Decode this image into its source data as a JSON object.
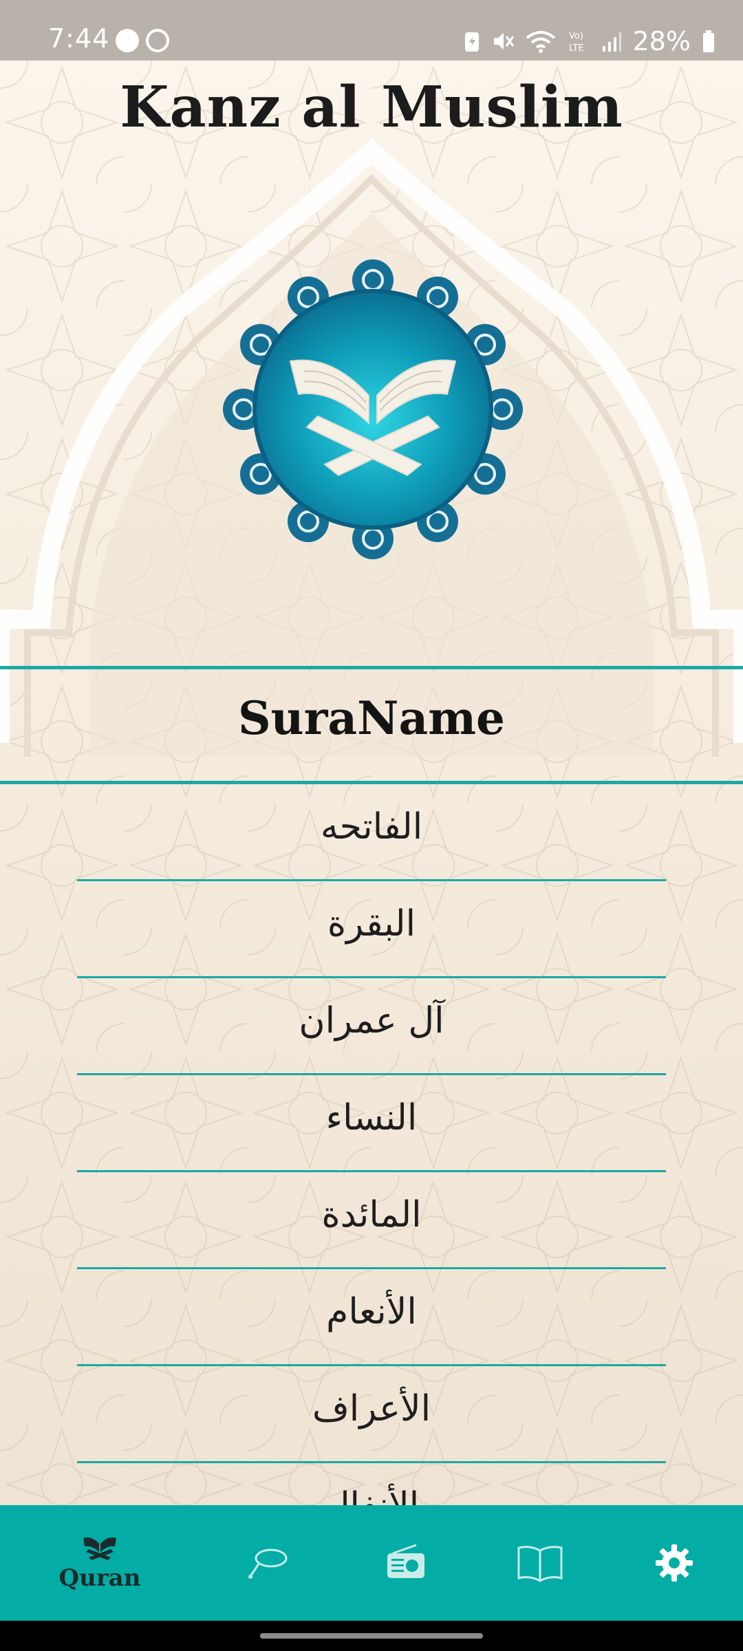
{
  "status_bar": {
    "time": "7:44",
    "battery": "28%",
    "left_icons": [
      "messenger-icon",
      "whatsapp-icon"
    ],
    "right_icons": [
      "battery-saver-icon",
      "mute-icon",
      "wifi-icon",
      "volte-icon",
      "signal-icon",
      "battery-icon"
    ]
  },
  "app": {
    "title": "Kanz al Muslim"
  },
  "list_header": "SuraName",
  "suras": [
    {
      "name": "الفاتحه"
    },
    {
      "name": "البقرة"
    },
    {
      "name": "آل عمران"
    },
    {
      "name": "النساء"
    },
    {
      "name": "المائدة"
    },
    {
      "name": "الأنعام"
    },
    {
      "name": "الأعراف"
    },
    {
      "name": "الأنفال"
    }
  ],
  "bottom_nav": {
    "items": [
      {
        "id": "quran",
        "icon": "quran-icon",
        "label": "Quran",
        "active": true
      },
      {
        "id": "tasbih",
        "icon": "tasbih-icon",
        "label": ""
      },
      {
        "id": "radio",
        "icon": "radio-icon",
        "label": ""
      },
      {
        "id": "hadith",
        "icon": "book-icon",
        "label": ""
      },
      {
        "id": "settings",
        "icon": "gear-icon",
        "label": ""
      }
    ]
  },
  "colors": {
    "accent": "#1aa9a4",
    "nav_background": "#04aca6",
    "logo_blue": "#0f7f9c"
  }
}
